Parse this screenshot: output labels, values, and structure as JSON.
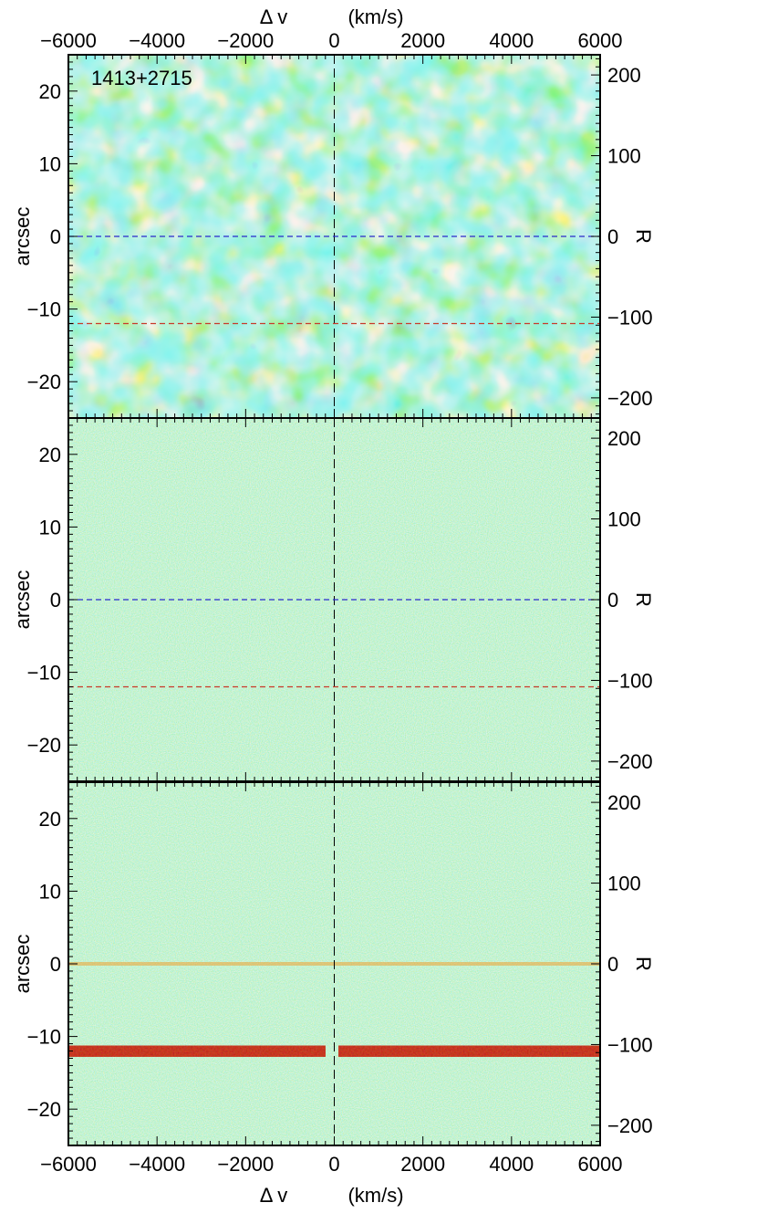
{
  "chart_data": [
    {
      "type": "heatmap",
      "panel": "top",
      "annotation": "1413+2715",
      "xlim": [
        -6000,
        6000
      ],
      "ylim": [
        -25,
        25
      ],
      "right_axis_ylim": [
        -225,
        225
      ],
      "xlabel_top": "Δ v",
      "xunit_top": "(km/s)",
      "ylabel": "arcsec",
      "right_label": "R⊥",
      "x_ticks": [
        -6000,
        -4000,
        -2000,
        0,
        2000,
        4000,
        6000
      ],
      "y_ticks": [
        -20,
        -10,
        0,
        10,
        20
      ],
      "right_ticks": [
        -200,
        -100,
        0,
        100,
        200
      ],
      "reference_lines": [
        {
          "axis": "x",
          "value": 0,
          "color": "#000000",
          "style": "dashed"
        },
        {
          "axis": "y",
          "value": 0,
          "color": "#2a2acc",
          "style": "dashed"
        },
        {
          "axis": "y",
          "value": -12,
          "color": "#c83a2a",
          "style": "dashed"
        }
      ],
      "texture": "smoothed"
    },
    {
      "type": "heatmap",
      "panel": "middle",
      "xlim": [
        -6000,
        6000
      ],
      "ylim": [
        -25,
        25
      ],
      "right_axis_ylim": [
        -225,
        225
      ],
      "ylabel": "arcsec",
      "right_label": "R⊥",
      "y_ticks": [
        -20,
        -10,
        0,
        10,
        20
      ],
      "right_ticks": [
        -200,
        -100,
        0,
        100,
        200
      ],
      "reference_lines": [
        {
          "axis": "x",
          "value": 0,
          "color": "#000000",
          "style": "dashed"
        },
        {
          "axis": "y",
          "value": 0,
          "color": "#2a2acc",
          "style": "dashed"
        },
        {
          "axis": "y",
          "value": -12,
          "color": "#c83a2a",
          "style": "dashed"
        }
      ],
      "texture": "noise"
    },
    {
      "type": "heatmap",
      "panel": "bottom",
      "xlim": [
        -6000,
        6000
      ],
      "ylim": [
        -25,
        25
      ],
      "right_axis_ylim": [
        -225,
        225
      ],
      "xlabel_bottom": "Δ v",
      "xunit_bottom": "(km/s)",
      "ylabel": "arcsec",
      "right_label": "R⊥",
      "x_ticks": [
        -6000,
        -4000,
        -2000,
        0,
        2000,
        4000,
        6000
      ],
      "y_ticks": [
        -20,
        -10,
        0,
        10,
        20
      ],
      "right_ticks": [
        -200,
        -100,
        0,
        100,
        200
      ],
      "reference_lines": [
        {
          "axis": "x",
          "value": 0,
          "color": "#000000",
          "style": "dashed"
        }
      ],
      "bright_trace_y": 0,
      "strong_trace": {
        "y": -12,
        "gap_x": [
          -200,
          100
        ]
      },
      "texture": "noise"
    }
  ],
  "colors": {
    "background": "#7fe3a7",
    "low": "#1f7fe0",
    "mid": "#5fd0d0",
    "high": "#f0ec40",
    "peak": "#f07a2a",
    "trace": "#8b0000"
  }
}
